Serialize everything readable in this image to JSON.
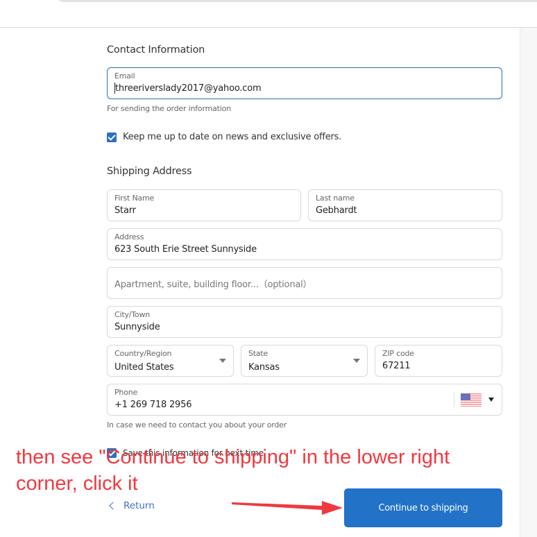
{
  "contact": {
    "title": "Contact Information",
    "email": {
      "label": "Email",
      "value": "threeriverslady2017@yahoo.com",
      "help": "For sending the order information"
    },
    "newsletter": {
      "label": "Keep me up to date on news and exclusive offers.",
      "checked": true
    }
  },
  "shipping": {
    "title": "Shipping Address",
    "first_name": {
      "label": "First Name",
      "value": "Starr"
    },
    "last_name": {
      "label": "Last name",
      "value": "Gebhardt"
    },
    "address": {
      "label": "Address",
      "value": "623 South Erie Street Sunnyside"
    },
    "apartment": {
      "placeholder": "Apartment, suite, building floor...（optional）"
    },
    "city": {
      "label": "City/Town",
      "value": "Sunnyside"
    },
    "country": {
      "label": "Country/Region",
      "value": "United States"
    },
    "state": {
      "label": "State",
      "value": "Kansas"
    },
    "zip": {
      "label": "ZIP code",
      "value": "67211"
    },
    "phone": {
      "label": "Phone",
      "value": "+1 269 718 2956",
      "country_flag": "us-flag-icon",
      "help": "In case we need to contact you about your order"
    },
    "save_info": {
      "label": "Save this information for next time",
      "checked": true
    }
  },
  "actions": {
    "return_label": "Return",
    "continue_label": "Continue to shipping"
  },
  "annotation": {
    "text": "then see \"Continue to shipping\" in the lower right corner, click it",
    "color": "#f0383f"
  },
  "colors": {
    "accent": "#2272c7",
    "focus_border": "#2a6db3",
    "checkbox": "#2d6fc0"
  }
}
